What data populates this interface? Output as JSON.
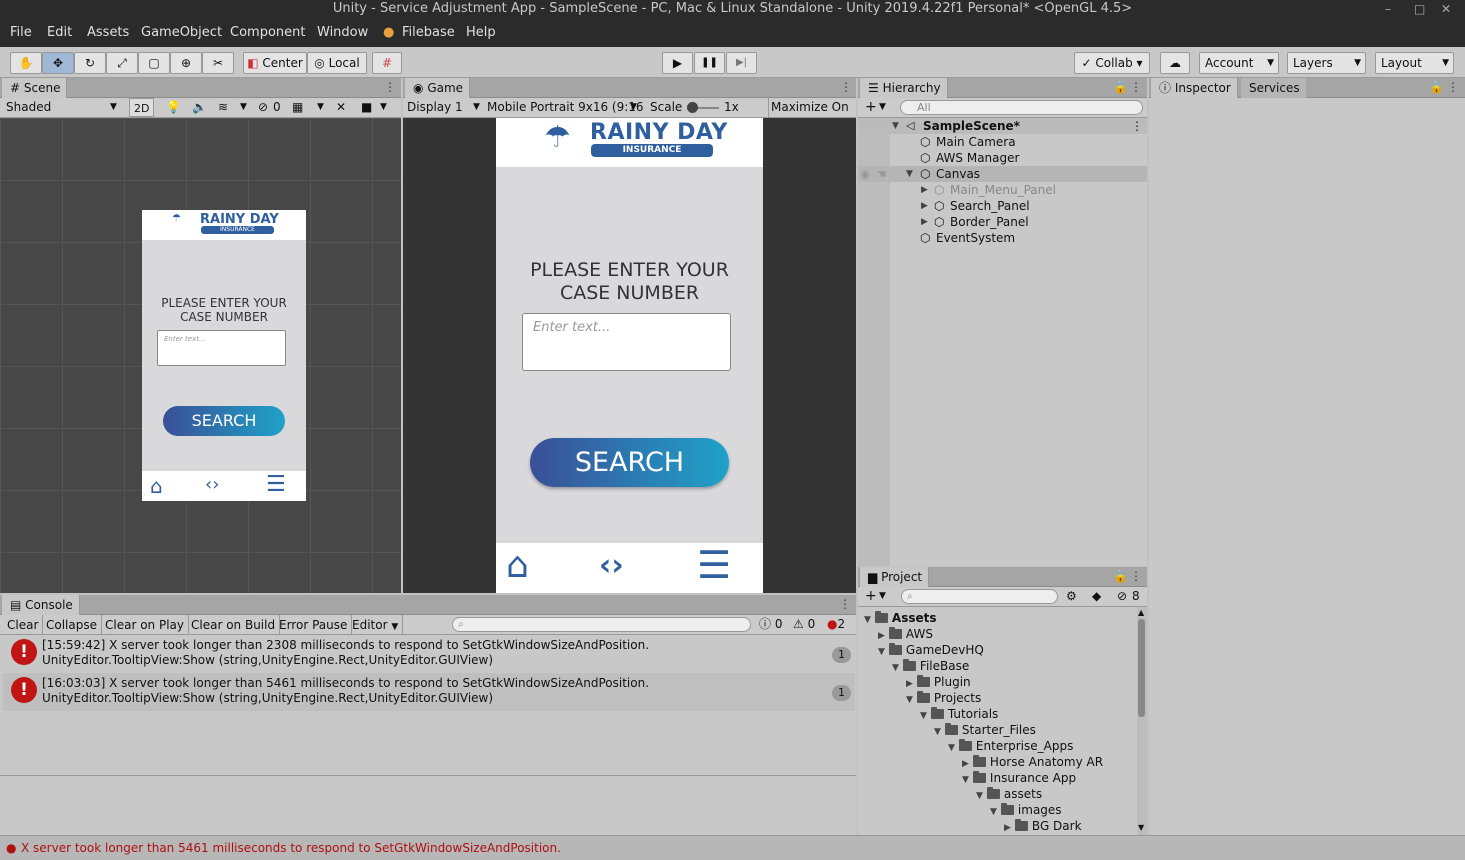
{
  "window": {
    "title": "Unity - Service Adjustment App - SampleScene - PC, Mac & Linux Standalone - Unity 2019.4.22f1 Personal* <OpenGL 4.5>",
    "min": "–",
    "max": "□",
    "close": "✕"
  },
  "menu": [
    "File",
    "Edit",
    "Assets",
    "GameObject",
    "Component",
    "Window",
    "Filebase",
    "Help"
  ],
  "toolbar": {
    "center": "Center",
    "local": "Local",
    "collab": "Collab ▾",
    "account": "Account",
    "layers": "Layers",
    "layout": "Layout",
    "play": "▶",
    "pause": "❚❚",
    "step": "▶|"
  },
  "scene": {
    "tab": "Scene",
    "shading": "Shaded",
    "mode2d": "2D",
    "hidden_count": "0"
  },
  "game": {
    "tab": "Game",
    "display": "Display 1",
    "resolution": "Mobile Portrait 9x16 (9:16",
    "scale_label": "Scale",
    "scale_value": "1x",
    "maximize": "Maximize On Pl"
  },
  "app": {
    "brand": "RAINY DAY",
    "sub": "INSURANCE",
    "prompt_line1": "PLEASE ENTER YOUR",
    "prompt_line2": "CASE NUMBER",
    "placeholder": "Enter text...",
    "search": "SEARCH"
  },
  "hierarchy": {
    "tab": "Hierarchy",
    "search_placeholder": "All",
    "scene": "SampleScene*",
    "items": [
      "Main Camera",
      "AWS Manager",
      "Canvas",
      "Main_Menu_Panel",
      "Search_Panel",
      "Border_Panel",
      "EventSystem"
    ]
  },
  "inspector": {
    "tab": "Inspector",
    "services": "Services"
  },
  "project": {
    "tab": "Project",
    "badge": "8",
    "tree": [
      "Assets",
      "AWS",
      "GameDevHQ",
      "FileBase",
      "Plugin",
      "Projects",
      "Tutorials",
      "Starter_Files",
      "Enterprise_Apps",
      "Horse Anatomy AR",
      "Insurance App",
      "assets",
      "images",
      "BG Dark"
    ]
  },
  "console": {
    "tab": "Console",
    "clear": "Clear",
    "collapse": "Collapse",
    "clear_on_play": "Clear on Play",
    "clear_on_build": "Clear on Build",
    "error_pause": "Error Pause",
    "editor": "Editor",
    "info_count": "0",
    "warn_count": "0",
    "error_count": "2",
    "entries": [
      {
        "line1": "[15:59:42] X server took longer than 2308 milliseconds to respond to SetGtkWindowSizeAndPosition.",
        "line2": "UnityEditor.TooltipView:Show (string,UnityEngine.Rect,UnityEditor.GUIView)",
        "count": "1"
      },
      {
        "line1": "[16:03:03] X server took longer than 5461 milliseconds to respond to SetGtkWindowSizeAndPosition.",
        "line2": "UnityEditor.TooltipView:Show (string,UnityEngine.Rect,UnityEditor.GUIView)",
        "count": "1"
      }
    ]
  },
  "status": {
    "message": "X server took longer than 5461 milliseconds to respond to SetGtkWindowSizeAndPosition."
  }
}
